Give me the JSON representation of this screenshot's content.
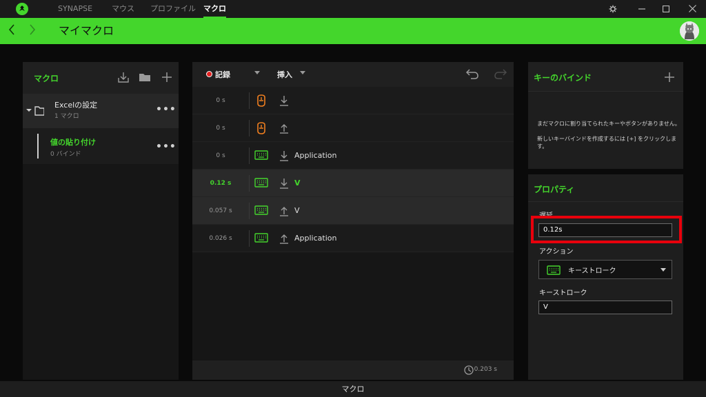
{
  "topbar": {
    "tabs": [
      {
        "label": "SYNAPSE",
        "active": false
      },
      {
        "label": "マウス",
        "active": false
      },
      {
        "label": "プロファイル",
        "active": false
      },
      {
        "label": "マクロ",
        "active": true
      }
    ],
    "icons": [
      "razer-logo-icon",
      "settings-icon",
      "minimize-icon",
      "maximize-icon",
      "close-icon"
    ]
  },
  "header": {
    "title": "マイマクロ"
  },
  "left": {
    "title": "マクロ",
    "folder": {
      "name": "Excelの設定",
      "count": "1 マクロ"
    },
    "macro": {
      "name": "値の貼り付け",
      "binds": "0 バインド"
    },
    "menu_glyph": "•••"
  },
  "editor": {
    "record_label": "記録",
    "insert_label": "挿入",
    "rows": [
      {
        "time": "0 s",
        "device": "mouse",
        "direction": "down",
        "label": "",
        "highlight": false,
        "active": false
      },
      {
        "time": "0 s",
        "device": "mouse",
        "direction": "up",
        "label": "",
        "highlight": false,
        "active": false
      },
      {
        "time": "0 s",
        "device": "keyboard",
        "direction": "down",
        "label": "Application",
        "highlight": false,
        "active": false
      },
      {
        "time": "0.12 s",
        "device": "keyboard",
        "direction": "down",
        "label": "V",
        "highlight": true,
        "active": true
      },
      {
        "time": "0.057 s",
        "device": "keyboard",
        "direction": "up",
        "label": "V",
        "highlight": true,
        "active": false
      },
      {
        "time": "0.026 s",
        "device": "keyboard",
        "direction": "up",
        "label": "Application",
        "highlight": false,
        "active": false
      }
    ],
    "total_time": "0.203 s"
  },
  "keybind": {
    "title": "キーのバインド",
    "line1": "まだマクロに割り当てられたキーやボタンがありません。",
    "line2": "新しいキーバインドを作成するには [+] をクリックします。"
  },
  "properties": {
    "title": "プロパティ",
    "delay_label": "遅延",
    "delay_value": "0.12s",
    "action_label": "アクション",
    "action_value": "キーストローク",
    "keystroke_label": "キーストローク",
    "keystroke_value": "V"
  },
  "footer": {
    "label": "マクロ"
  },
  "colors": {
    "accent": "#44d62c",
    "highlight": "#e8000c",
    "mouse_icon": "#f07f1f"
  }
}
